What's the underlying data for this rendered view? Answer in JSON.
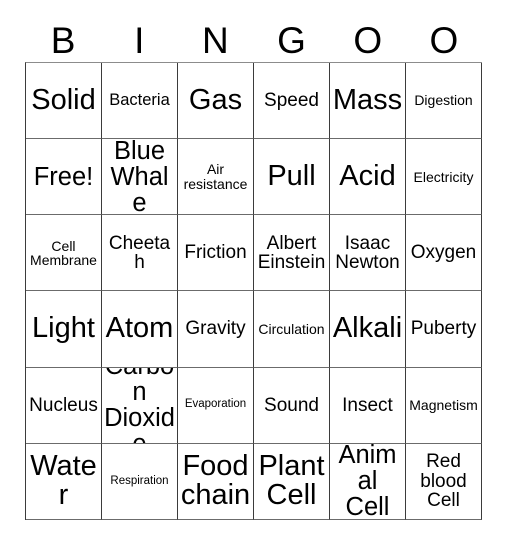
{
  "card": {
    "title_letters": [
      "B",
      "I",
      "N",
      "G",
      "O",
      "O"
    ],
    "columns": 6,
    "rows": 6,
    "cells": [
      [
        {
          "label": "Solid",
          "size": "xxl"
        },
        {
          "label": "Bacteria",
          "size": "m"
        },
        {
          "label": "Gas",
          "size": "xxl"
        },
        {
          "label": "Speed",
          "size": "ml"
        },
        {
          "label": "Mass",
          "size": "xxl"
        },
        {
          "label": "Digestion",
          "size": "s"
        }
      ],
      [
        {
          "label": "Free!",
          "size": "xl"
        },
        {
          "label": "Blue\nWhale",
          "size": "xl"
        },
        {
          "label": "Air\nresistance",
          "size": "s"
        },
        {
          "label": "Pull",
          "size": "xxl"
        },
        {
          "label": "Acid",
          "size": "xxl"
        },
        {
          "label": "Electricity",
          "size": "s"
        }
      ],
      [
        {
          "label": "Cell\nMembrane",
          "size": "s"
        },
        {
          "label": "Cheetah",
          "size": "ml"
        },
        {
          "label": "Friction",
          "size": "ml"
        },
        {
          "label": "Albert\nEinstein",
          "size": "ml"
        },
        {
          "label": "Isaac\nNewton",
          "size": "ml"
        },
        {
          "label": "Oxygen",
          "size": "ml"
        }
      ],
      [
        {
          "label": "Light",
          "size": "xxl"
        },
        {
          "label": "Atom",
          "size": "xxl"
        },
        {
          "label": "Gravity",
          "size": "ml"
        },
        {
          "label": "Circulation",
          "size": "s"
        },
        {
          "label": "Alkali",
          "size": "xxl"
        },
        {
          "label": "Puberty",
          "size": "ml"
        }
      ],
      [
        {
          "label": "Nucleus",
          "size": "ml"
        },
        {
          "label": "Carbon\nDioxide",
          "size": "xl"
        },
        {
          "label": "Evaporation",
          "size": "xs"
        },
        {
          "label": "Sound",
          "size": "ml"
        },
        {
          "label": "Insect",
          "size": "ml"
        },
        {
          "label": "Magnetism",
          "size": "s"
        }
      ],
      [
        {
          "label": "Water",
          "size": "xxl"
        },
        {
          "label": "Respiration",
          "size": "xs"
        },
        {
          "label": "Food\nchain",
          "size": "xxl"
        },
        {
          "label": "Plant\nCell",
          "size": "xxl"
        },
        {
          "label": "Animal\nCell",
          "size": "xl"
        },
        {
          "label": "Red\nblood\nCell",
          "size": "ml"
        }
      ]
    ]
  },
  "colors": {
    "background": "#ffffff",
    "text": "#000000",
    "grid_line": "#3b3b3b"
  }
}
